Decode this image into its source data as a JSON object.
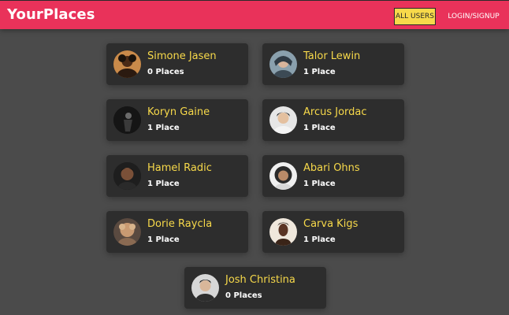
{
  "header": {
    "brand": "YourPlaces",
    "nav": {
      "all_users": "ALL USERS",
      "login": "LOGIN/SIGNUP"
    }
  },
  "colors": {
    "header_bg": "#e9325a",
    "accent_yellow": "#f7d94a",
    "card_bg": "#2d2d2d",
    "page_bg": "#4b4b4b"
  },
  "users": [
    {
      "name": "Simone Jasen",
      "places": "0 Places",
      "avatar": "user-avatar-icon"
    },
    {
      "name": "Talor Lewin",
      "places": "1 Place",
      "avatar": "user-avatar-icon"
    },
    {
      "name": "Koryn Gaine",
      "places": "1 Place",
      "avatar": "user-avatar-icon"
    },
    {
      "name": "Arcus Jordac",
      "places": "1 Place",
      "avatar": "user-avatar-icon"
    },
    {
      "name": "Hamel Radic",
      "places": "1 Place",
      "avatar": "user-avatar-icon"
    },
    {
      "name": "Abari Ohns",
      "places": "1 Place",
      "avatar": "user-avatar-icon"
    },
    {
      "name": "Dorie Raycla",
      "places": "1 Place",
      "avatar": "user-avatar-icon"
    },
    {
      "name": "Carva Kigs",
      "places": "1 Place",
      "avatar": "user-avatar-icon"
    },
    {
      "name": "Josh Christina",
      "places": "0 Places",
      "avatar": "user-avatar-icon"
    }
  ]
}
